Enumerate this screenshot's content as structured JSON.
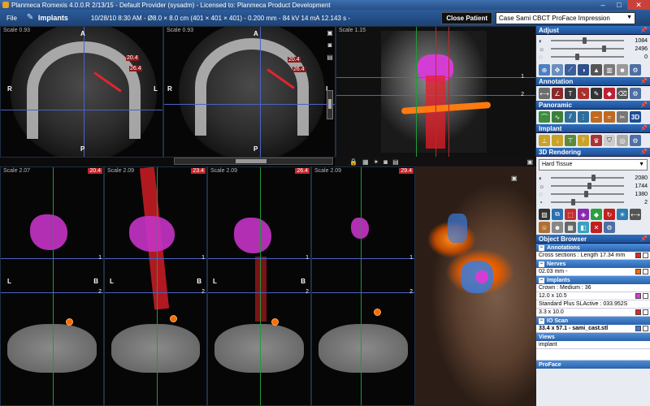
{
  "window": {
    "title": "Planmeca Romexis 4.0.0.R  2/13/15 - Default Provider (sysadm) - Licensed to: Planmeca Product Development"
  },
  "toolbar": {
    "file_menu": "File",
    "active_tab": "Implants",
    "info": "10/28/10 8:30 AM - Ø8.0 × 8.0 cm (401 × 401 × 401) - 0.200 mm - 84 kV 14 mA 12.143 s -",
    "close_patient": "Close Patient",
    "case_selected": "Case Sami  CBCT ProFace Impression"
  },
  "views": {
    "axial1": {
      "scale": "Scale 0.93",
      "m1": "20.4",
      "m2": "26.4",
      "top": "A",
      "bottom": "P",
      "left": "R",
      "right": "L"
    },
    "axial2": {
      "scale": "Scale 0.93",
      "m1": "20.4",
      "m2": "26.4",
      "top": "A",
      "bottom": "P",
      "left": "R",
      "right": "L"
    },
    "pano": {
      "scale": "Scale 1.15",
      "n1": "1",
      "n2": "2"
    },
    "cs": [
      {
        "scale": "Scale 2.07",
        "num": "20.4",
        "left": "L",
        "right": "B",
        "t1": "1",
        "t2": "2"
      },
      {
        "scale": "Scale 2.09",
        "num": "23.4",
        "left": "L",
        "right": "B",
        "t1": "1",
        "t2": "2"
      },
      {
        "scale": "Scale 2.09",
        "num": "26.4",
        "left": "L",
        "right": "B",
        "t1": "1",
        "t2": "2"
      },
      {
        "scale": "Scale 2.09",
        "num": "29.4",
        "left": "L",
        "right": "B",
        "t1": "1",
        "t2": "2"
      }
    ]
  },
  "panel": {
    "adjust": {
      "title": "Adjust",
      "sliders": [
        {
          "icon": "◐",
          "value": "1084",
          "pct": 0.45
        },
        {
          "icon": "☼",
          "value": "2496",
          "pct": 0.72
        },
        {
          "icon": "◌",
          "value": "0",
          "pct": 0.35
        }
      ]
    },
    "annotation": {
      "title": "Annotation"
    },
    "panoramic": {
      "title": "Panoramic",
      "btn3d": "3D"
    },
    "implant": {
      "title": "Implant"
    },
    "rendering": {
      "title": "3D Rendering",
      "preset": "Hard Tissue",
      "sliders": [
        {
          "icon": "◐",
          "value": "2080",
          "pct": 0.58
        },
        {
          "icon": "☼",
          "value": "1744",
          "pct": 0.52
        },
        {
          "icon": "◌",
          "value": "1380",
          "pct": 0.48
        },
        {
          "icon": "◔",
          "value": "2",
          "pct": 0.3
        }
      ]
    },
    "object_browser": {
      "title": "Object Browser",
      "annotations_sec": "Annotations",
      "annotation_item": "Cross sections : Length 17.34 mm",
      "nerves_sec": "Nerves",
      "nerve_item": "02.03 mm -",
      "implants_sec": "Implants",
      "implant_items": [
        "Crown : Medium : 36",
        "12.0 x 10.5",
        "Standard Plus SLActive : 033.952S",
        "3.3 x 10.0"
      ],
      "scan_sec": "IO Scan",
      "scan_item": "33.4 x 57.1 - sami_cast.stl",
      "views_sec": "Views",
      "view_item": "implant",
      "proface": "ProFace"
    }
  },
  "colors": {
    "accent": "#2f6fc0",
    "implant_red": "#e0262b",
    "crown_pink": "#c533c5",
    "nerve_orange": "#ff6a00"
  }
}
